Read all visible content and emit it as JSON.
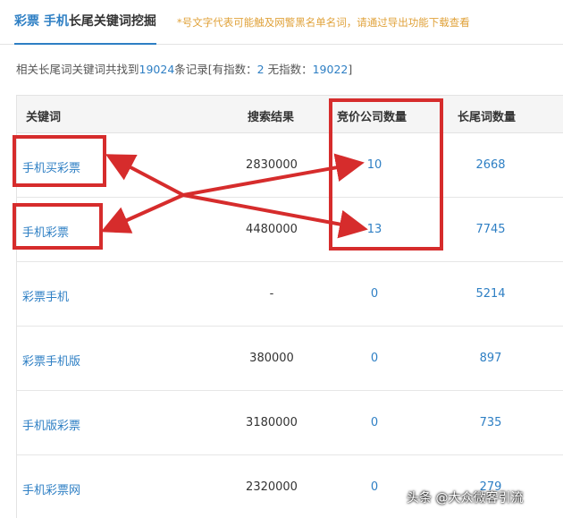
{
  "tab": {
    "keyword_1": "彩票",
    "keyword_2": "手机",
    "label": "长尾关键词挖掘",
    "note": "*号文字代表可能触及网警黑名单名词，请通过导出功能下载查看"
  },
  "summary": {
    "prefix": "相关长尾词关键词共找到",
    "total": "19024",
    "mid": "条记录[有指数：",
    "with_index": "2",
    "mid2": "  无指数：",
    "without_index": "19022",
    "suffix": "]"
  },
  "table": {
    "headers": [
      "关键词",
      "搜索结果",
      "竞价公司数量",
      "长尾词数量"
    ],
    "rows": [
      {
        "keyword": "手机买彩票",
        "results": "2830000",
        "bid_companies": "10",
        "long_tail": "2668"
      },
      {
        "keyword": "手机彩票",
        "results": "4480000",
        "bid_companies": "13",
        "long_tail": "7745"
      },
      {
        "keyword": "彩票手机",
        "results": "-",
        "bid_companies": "0",
        "long_tail": "5214"
      },
      {
        "keyword": "彩票手机版",
        "results": "380000",
        "bid_companies": "0",
        "long_tail": "897"
      },
      {
        "keyword": "手机版彩票",
        "results": "3180000",
        "bid_companies": "0",
        "long_tail": "735"
      },
      {
        "keyword": "手机彩票网",
        "results": "2320000",
        "bid_companies": "0",
        "long_tail": "279"
      }
    ]
  },
  "annotation_color": "#d62c2c",
  "watermark": "头条 @大众微客引流"
}
